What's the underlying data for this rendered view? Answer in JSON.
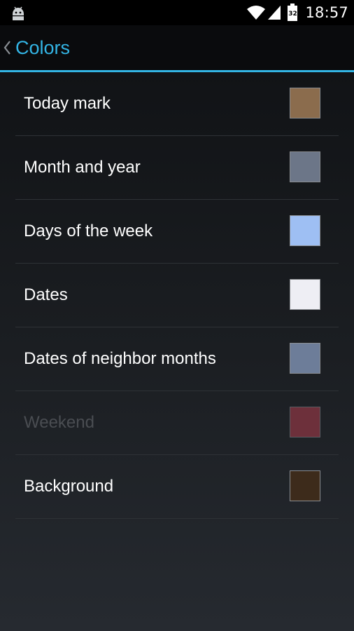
{
  "status_bar": {
    "time": "18:57",
    "battery_level": "32",
    "icons": [
      "android-icon",
      "wifi-icon",
      "signal-icon",
      "battery-icon"
    ]
  },
  "action_bar": {
    "title": "Colors",
    "accent_color": "#33b5e5"
  },
  "colors": {
    "items": [
      {
        "label": "Today mark",
        "color": "#8b6c4d",
        "enabled": true
      },
      {
        "label": "Month and year",
        "color": "#6c7688",
        "enabled": true
      },
      {
        "label": "Days of the week",
        "color": "#9ebff3",
        "enabled": true
      },
      {
        "label": "Dates",
        "color": "#eeeef4",
        "enabled": true
      },
      {
        "label": "Dates of neighbor months",
        "color": "#6d7d99",
        "enabled": true
      },
      {
        "label": "Weekend",
        "color": "#6d303b",
        "enabled": false
      },
      {
        "label": "Background",
        "color": "#3d2b1b",
        "enabled": true
      }
    ]
  }
}
